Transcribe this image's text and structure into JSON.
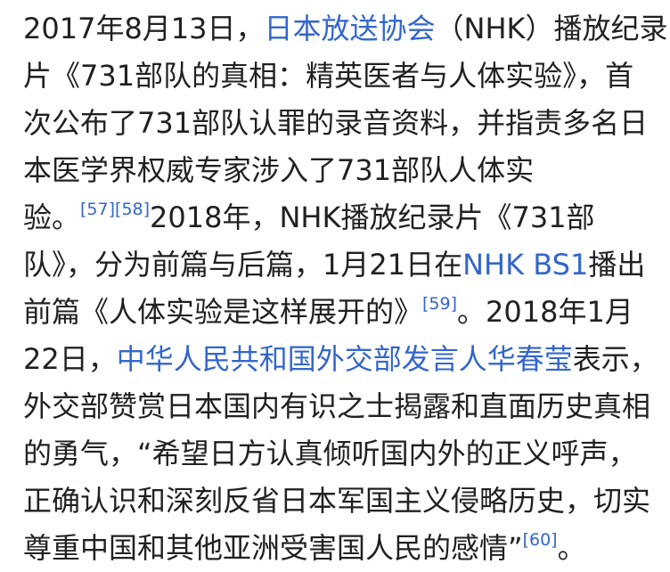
{
  "article": {
    "line1": {
      "t1": "2017年8月13日，",
      "link_nhk": "日本放送协会",
      "t2": "（NHK）播放纪录"
    },
    "line2": "片《731部队的真相：精英医者与人体实验》，首",
    "line3": "次公布了731部队认罪的录音资料，并指责多名日",
    "line4": "本医学界权威专家涉入了731部队人体实",
    "line5": {
      "t1": "验。",
      "ref57": "[57]",
      "ref58": "[58]",
      "t2": "2018年，NHK播放纪录片《731部"
    },
    "line6": {
      "t1": "队》，分为前篇与后篇，1月21日在",
      "link_bs1": "NHK BS1",
      "t2": "播出"
    },
    "line7": {
      "t1": "前篇《人体实验是这样展开的》",
      "ref59": "[59]",
      "t2": "。2018年1月"
    },
    "line8": {
      "t1": "22日，",
      "link_mfa": "中华人民共和国外交部发言人",
      "link_spokesperson": "华春莹",
      "t2": "表示，"
    },
    "line9": "外交部赞赏日本国内有识之士揭露和直面历史真相",
    "line10": "的勇气，“希望日方认真倾听国内外的正义呼声，",
    "line11": "正确认识和深刻反省日本军国主义侵略历史，切实",
    "line12": {
      "t1": "尊重中国和其他亚洲受害国人民的感情”",
      "ref60": "[60]",
      "t2": "。"
    }
  },
  "colors": {
    "text": "#202122",
    "link": "#3366cc",
    "background": "#ffffff"
  }
}
